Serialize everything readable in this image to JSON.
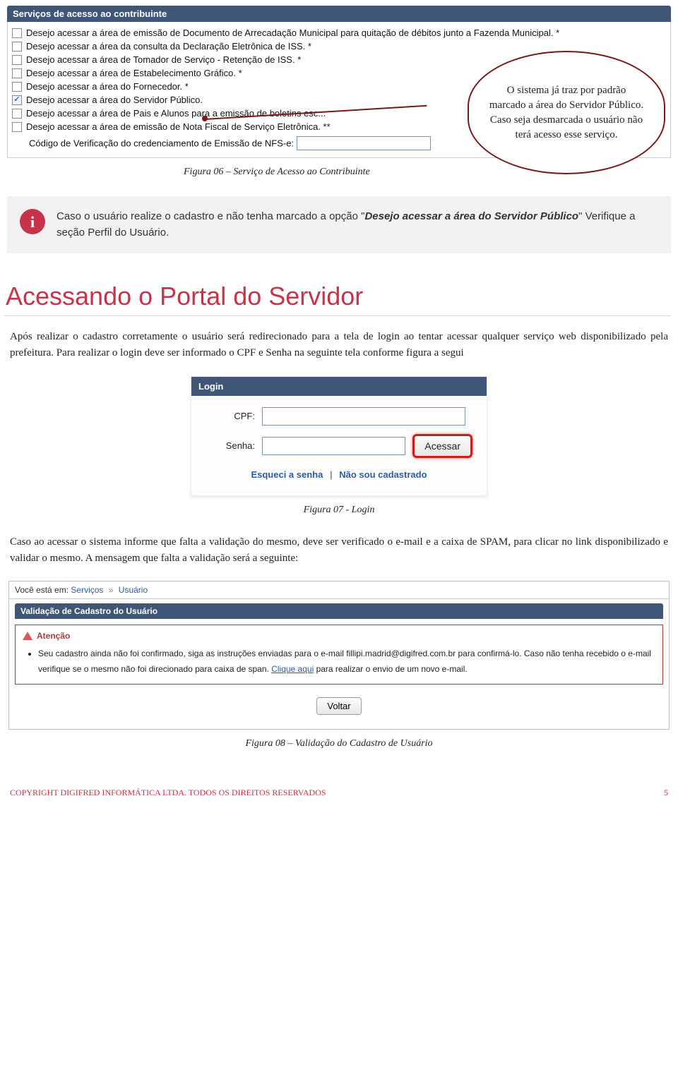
{
  "servicesPanel": {
    "title": "Serviços de acesso ao contribuinte",
    "items": [
      {
        "checked": false,
        "label": "Desejo acessar a área de emissão de Documento de Arrecadação Municipal para quitação de débitos junto a Fazenda Municipal. *"
      },
      {
        "checked": false,
        "label": "Desejo acessar a área da consulta da Declaração Eletrônica de ISS. *"
      },
      {
        "checked": false,
        "label": "Desejo acessar a área de Tomador de Serviço - Retenção de ISS. *"
      },
      {
        "checked": false,
        "label": "Desejo acessar a área de Estabelecimento Gráfico. *"
      },
      {
        "checked": false,
        "label": "Desejo acessar a área do Fornecedor. *"
      },
      {
        "checked": true,
        "label": "Desejo acessar a área do Servidor Público."
      },
      {
        "checked": false,
        "label": "Desejo acessar a área de Pais e Alunos para a emissão de boletins esc..."
      },
      {
        "checked": false,
        "label": "Desejo acessar a área de emissão de Nota Fiscal de Serviço Eletrônica. **"
      }
    ],
    "codeLabel": "Código de Verificação do credenciamento de Emissão de NFS-e:"
  },
  "callout": "O sistema já traz por padrão marcado a área do Servidor Público. Caso seja desmarcada o usuário não terá acesso esse serviço.",
  "captions": {
    "fig06": "Figura 06 – Serviço de Acesso ao Contribuinte",
    "fig07": "Figura 07 - Login",
    "fig08": "Figura 08 – Validação do Cadastro de Usuário"
  },
  "infoBox": {
    "icon": "i",
    "textPrefix": "Caso o usuário realize o cadastro e não tenha marcado a opção \"",
    "bold": "Desejo acessar a área do Servidor Público",
    "textSuffix": "\" Verifique a seção Perfil do Usuário."
  },
  "heading": "Acessando o Portal do Servidor",
  "para1": "Após realizar o cadastro corretamente o usuário será redirecionado para a tela de login ao tentar acessar qualquer serviço web disponibilizado pela prefeitura. Para realizar o login deve ser informado o CPF e Senha na seguinte tela conforme figura a segui",
  "login": {
    "title": "Login",
    "cpfLabel": "CPF:",
    "senhaLabel": "Senha:",
    "button": "Acessar",
    "link1": "Esqueci a senha",
    "sep": "|",
    "link2": "Não sou cadastrado"
  },
  "para2": "Caso ao acessar o sistema informe que falta a validação do mesmo, deve ser verificado o e-mail e a caixa de SPAM, para clicar no link disponibilizado e validar o mesmo. A mensagem que falta a validação será a seguinte:",
  "validation": {
    "breadcrumb": {
      "prefix": "Você está em:",
      "link1": "Serviços",
      "sep": "»",
      "link2": "Usuário"
    },
    "panelTitle": "Validação de Cadastro do Usuário",
    "alertTitle": "Atenção",
    "alertLinePrefix": "Seu cadastro ainda não foi confirmado, siga as instruções enviadas para o e-mail fillipi.madrid@digifred.com.br para confirmá-lo. Caso não tenha recebido o e-mail verifique se o mesmo não foi direcionado para caixa de span. ",
    "alertLink": "Clique aqui",
    "alertLineSuffix": " para realizar o envio de um novo e-mail.",
    "voltar": "Voltar"
  },
  "footer": {
    "left": "COPYRIGHT DIGIFRED INFORMÁTICA LTDA. TODOS OS DIREITOS RESERVADOS",
    "page": "5"
  }
}
